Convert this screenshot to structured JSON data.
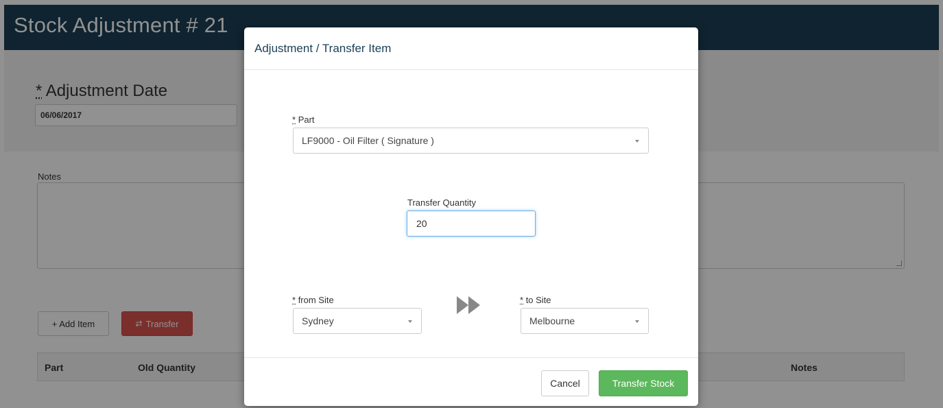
{
  "page": {
    "title": "Stock Adjustment # 21",
    "date_label": "Adjustment Date",
    "date_value": "06/06/2017",
    "notes_label": "Notes",
    "add_item_label": "+ Add Item",
    "transfer_label": "Transfer",
    "table_headers": [
      "Part",
      "Old Quantity",
      "Notes"
    ]
  },
  "modal": {
    "title": "Adjustment / Transfer Item",
    "part_label": "Part",
    "part_value": "LF9000 - Oil Filter ( Signature )",
    "qty_label": "Transfer Quantity",
    "qty_value": "20",
    "from_label": "from Site",
    "from_value": "Sydney",
    "to_label": "to Site",
    "to_value": "Melbourne",
    "cancel_label": "Cancel",
    "submit_label": "Transfer Stock"
  },
  "required_marker": "*",
  "colors": {
    "header_bg": "#1c3f55",
    "danger": "#d9534f",
    "success": "#5cb85c",
    "focus": "#66afe9"
  },
  "icons": {
    "transfer": "transfer-arrows-icon",
    "arrow": "double-arrow-right-icon",
    "caret": "chevron-down-icon"
  }
}
